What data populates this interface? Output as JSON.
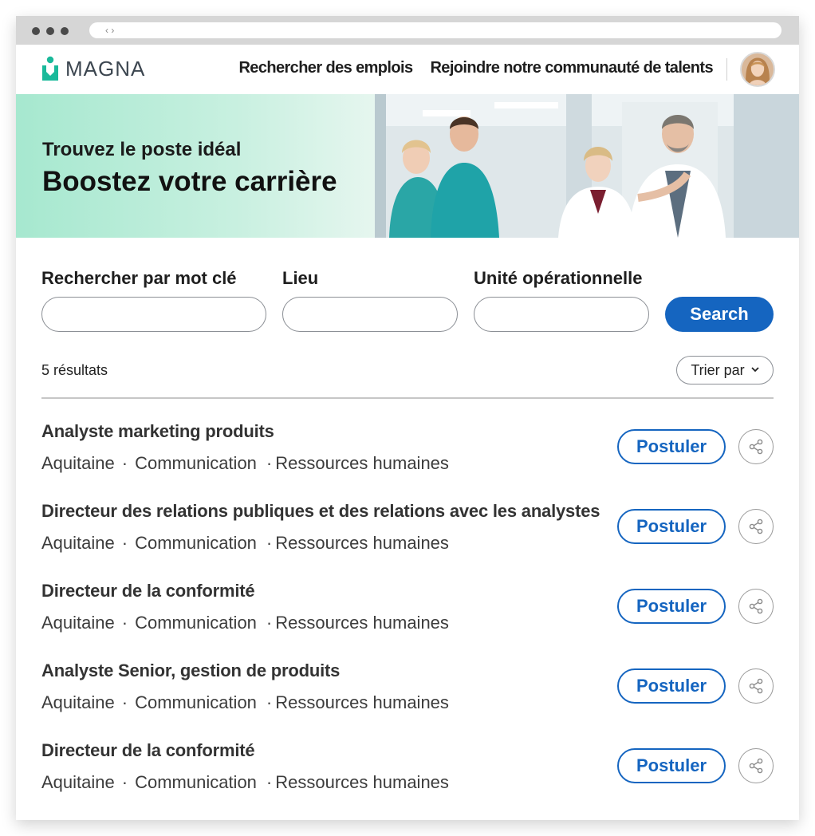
{
  "browser": {
    "nav_arrows": "‹ ›"
  },
  "brand": {
    "name": "MAGNA",
    "color": "#1ab99a"
  },
  "nav": {
    "links": [
      "Rechercher des emplois",
      "Rejoindre notre communauté de talents"
    ]
  },
  "hero": {
    "subtitle": "Trouvez le poste idéal",
    "title": "Boostez votre carrière"
  },
  "search": {
    "keyword_label": "Rechercher par mot clé",
    "keyword_value": "",
    "location_label": "Lieu",
    "location_value": "",
    "unit_label": "Unité opérationnelle",
    "unit_value": "",
    "button_label": "Search"
  },
  "results": {
    "count_text": "5 résultats",
    "sort_label": "Trier par"
  },
  "jobs": [
    {
      "title": "Analyste marketing produits",
      "location": "Aquitaine",
      "tags": [
        "Communication",
        "Ressources humaines"
      ],
      "apply_label": "Postuler"
    },
    {
      "title": "Directeur des relations publiques et des relations avec les analystes",
      "location": "Aquitaine",
      "tags": [
        "Communication",
        "Ressources humaines"
      ],
      "apply_label": "Postuler"
    },
    {
      "title": "Directeur de la conformité",
      "location": "Aquitaine",
      "tags": [
        "Communication",
        "Ressources humaines"
      ],
      "apply_label": "Postuler"
    },
    {
      "title": "Analyste Senior, gestion de produits",
      "location": "Aquitaine",
      "tags": [
        "Communication",
        "Ressources humaines"
      ],
      "apply_label": "Postuler"
    },
    {
      "title": "Directeur de la conformité",
      "location": "Aquitaine",
      "tags": [
        "Communication",
        "Ressources humaines"
      ],
      "apply_label": "Postuler"
    }
  ],
  "colors": {
    "primary": "#1565c0",
    "hero_start": "#a6e8cf",
    "accent": "#1ab99a"
  }
}
